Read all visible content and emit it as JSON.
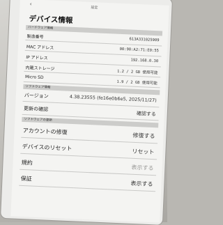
{
  "topbar": {
    "title": "設定"
  },
  "page": {
    "title": "デバイス情報"
  },
  "sections": {
    "hardware": "ハードウェア情報",
    "software": "ソフトウェア情報",
    "software_update": "ソフトウェアの更新"
  },
  "hardware_rows": [
    {
      "label": "製造番号",
      "value": "613A331025909"
    },
    {
      "label": "MAC アドレス",
      "value": "00:90:A2:71:E0:55"
    },
    {
      "label": "IP アドレス",
      "value": "192.168.0.30"
    },
    {
      "label": "内蔵ストレージ",
      "value": "1.2 / 2 GB 使用可能"
    },
    {
      "label": "Micro SD",
      "value": "1.9 / 2 GB 使用可能"
    }
  ],
  "software_rows": [
    {
      "label": "バージョン",
      "value": "4.38.23555 (fe16e0b6e5, 2025/11/27)"
    }
  ],
  "update_rows": [
    {
      "label": "更新の確認",
      "value": "確認する"
    }
  ],
  "action_rows": [
    {
      "label": "アカウントの修復",
      "value": "修復する"
    },
    {
      "label": "デバイスのリセット",
      "value": "リセット"
    },
    {
      "label": "規約",
      "value": "表示する"
    },
    {
      "label": "保証",
      "value": "表示する"
    }
  ]
}
